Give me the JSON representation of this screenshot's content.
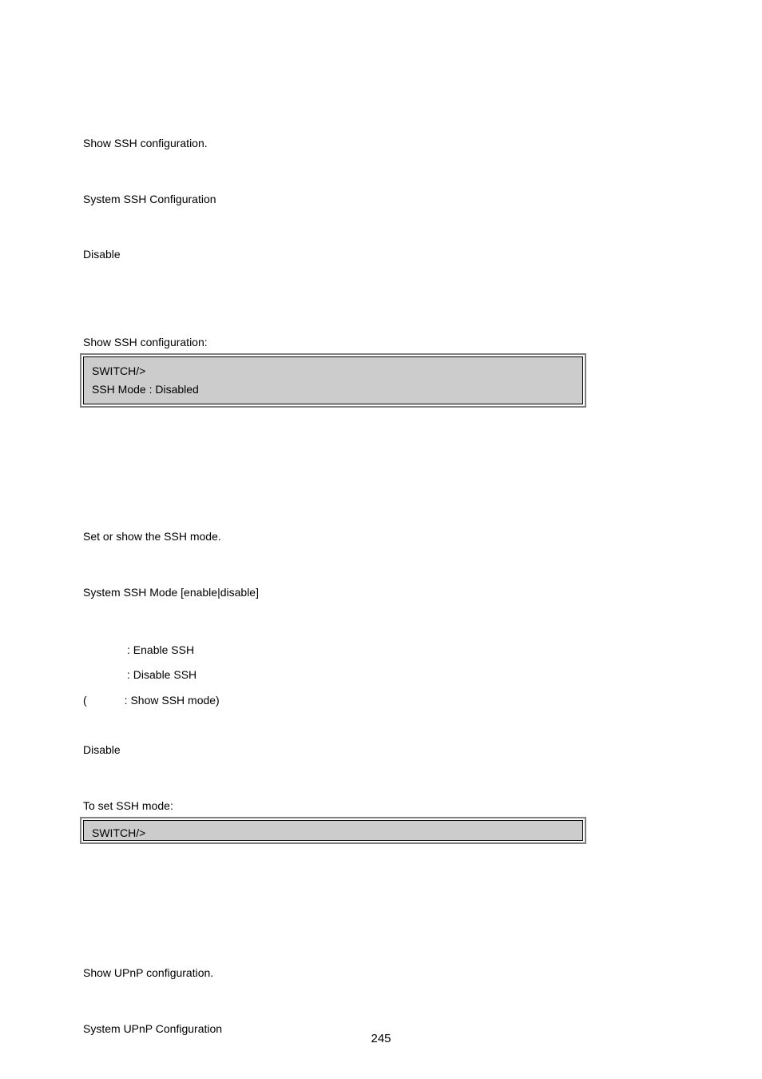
{
  "ssh_config": {
    "desc": "Show SSH configuration.",
    "syntax": "System SSH Configuration",
    "default": "Disable",
    "example_label": "Show SSH configuration:",
    "cli_prompt": "SWITCH/>",
    "cli_output": "SSH Mode : Disabled"
  },
  "ssh_mode": {
    "desc": "Set or show the SSH mode.",
    "syntax": "System SSH Mode [enable|disable]",
    "param_enable": ": Enable SSH",
    "param_disable": ": Disable SSH",
    "param_default_open": "(",
    "param_default": ": Show SSH mode)",
    "default": "Disable",
    "example_label": "To set SSH mode:",
    "cli_prompt": "SWITCH/>"
  },
  "upnp": {
    "desc": "Show UPnP configuration.",
    "syntax": "System UPnP Configuration"
  },
  "page_number": "245"
}
